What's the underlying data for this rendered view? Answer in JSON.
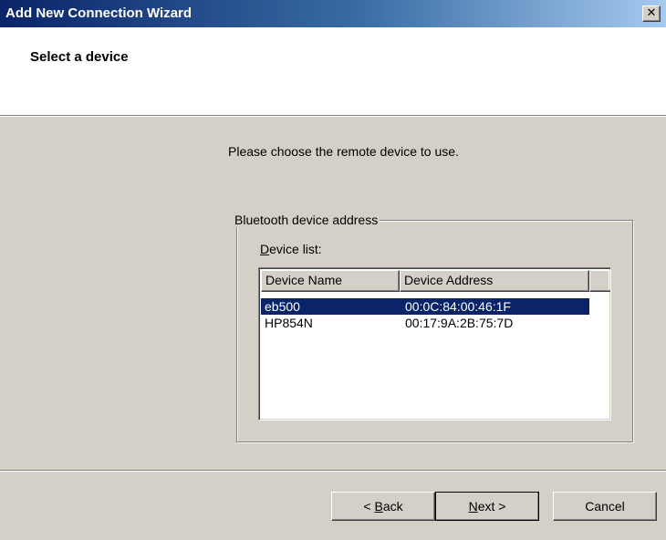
{
  "window": {
    "title": "Add New Connection Wizard",
    "close_glyph": "✕"
  },
  "header": {
    "title": "Select a device"
  },
  "prompt": "Please choose the remote device to use.",
  "group": {
    "legend": "Bluetooth device address",
    "list_label_prefix": "D",
    "list_label_rest": "evice list:"
  },
  "list": {
    "columns": [
      "Device Name",
      "Device Address"
    ],
    "rows": [
      {
        "name": "eb500",
        "address": "00:0C:84:00:46:1F",
        "selected": true
      },
      {
        "name": "HP854N",
        "address": "00:17:9A:2B:75:7D",
        "selected": false
      }
    ]
  },
  "buttons": {
    "back_prefix": "< ",
    "back_mnemonic": "B",
    "back_rest": "ack",
    "next_mnemonic": "N",
    "next_rest": "ext >",
    "cancel": "Cancel"
  },
  "colors": {
    "face": "#d4d0c8",
    "selection": "#0a246a",
    "title_start": "#0a246a",
    "title_end": "#a6caf0"
  }
}
